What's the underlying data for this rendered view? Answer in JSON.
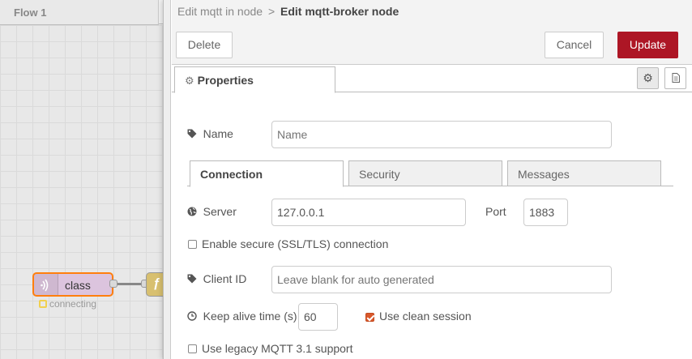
{
  "workspace": {
    "tab_label": "Flow 1",
    "node_class": {
      "label": "class",
      "status": "connecting"
    }
  },
  "tray": {
    "breadcrumb": {
      "parent": "Edit mqtt in node",
      "separator": ">",
      "current": "Edit mqtt-broker node"
    },
    "buttons": {
      "delete": "Delete",
      "cancel": "Cancel",
      "update": "Update"
    },
    "tabs": {
      "properties": "Properties"
    },
    "form": {
      "name": {
        "label": "Name",
        "placeholder": "Name",
        "value": ""
      },
      "config_tabs": [
        "Connection",
        "Security",
        "Messages"
      ],
      "server": {
        "label": "Server",
        "value": "127.0.0.1"
      },
      "port": {
        "label": "Port",
        "value": "1883"
      },
      "tls": {
        "label": "Enable secure (SSL/TLS) connection",
        "checked": false
      },
      "client_id": {
        "label": "Client ID",
        "placeholder": "Leave blank for auto generated"
      },
      "keep_alive": {
        "label": "Keep alive time (s)",
        "value": "60"
      },
      "clean_session": {
        "label": "Use clean session",
        "checked": true
      },
      "legacy": {
        "label": "Use legacy MQTT 3.1 support",
        "checked": false
      }
    }
  },
  "colors": {
    "update_button": "#ad1625",
    "checkbox_checked": "#d9582b",
    "node_border_selected": "#ff7f0e"
  },
  "icons": [
    "gear-icon",
    "file-icon",
    "tag-icon",
    "globe-icon",
    "clock-icon",
    "wifi-icon",
    "function-icon"
  ]
}
